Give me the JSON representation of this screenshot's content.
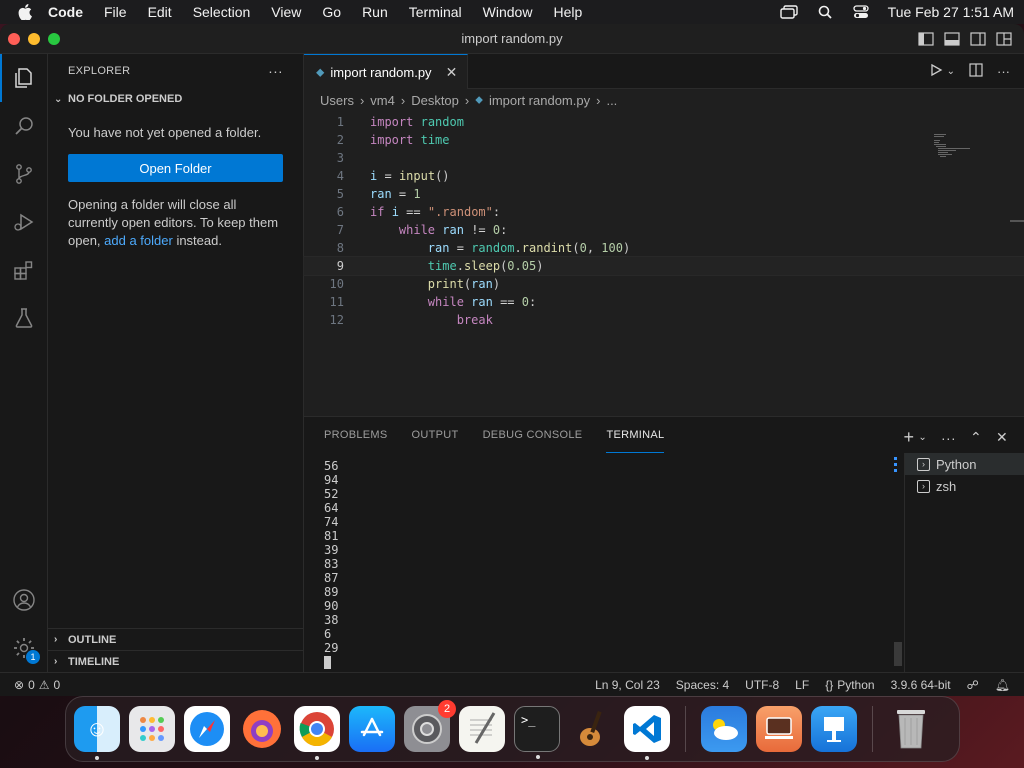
{
  "menubar": {
    "app": "Code",
    "items": [
      "File",
      "Edit",
      "Selection",
      "View",
      "Go",
      "Run",
      "Terminal",
      "Window",
      "Help"
    ],
    "clock": "Tue Feb 27  1:51 AM"
  },
  "window": {
    "title": "import random.py"
  },
  "sidebar": {
    "title": "EXPLORER",
    "section": "NO FOLDER OPENED",
    "message": "You have not yet opened a folder.",
    "open_button": "Open Folder",
    "info_1": "Opening a folder will close all currently open editors. To keep them open, ",
    "info_link": "add a folder",
    "info_2": " instead.",
    "outline": "OUTLINE",
    "timeline": "TIMELINE"
  },
  "editor": {
    "tab": "import random.py",
    "breadcrumb": [
      "Users",
      "vm4",
      "Desktop",
      "import random.py",
      "..."
    ],
    "current_line": 9
  },
  "panel": {
    "tabs": [
      "PROBLEMS",
      "OUTPUT",
      "DEBUG CONSOLE",
      "TERMINAL"
    ],
    "active_tab": "TERMINAL",
    "output": [
      "56",
      "94",
      "52",
      "64",
      "74",
      "81",
      "39",
      "83",
      "87",
      "89",
      "90",
      "38",
      "6",
      "29"
    ],
    "terminals": [
      "Python",
      "zsh"
    ]
  },
  "statusbar": {
    "errors": "0",
    "warnings": "0",
    "position": "Ln 9, Col 23",
    "spaces": "Spaces: 4",
    "encoding": "UTF-8",
    "eol": "LF",
    "language": "Python",
    "interpreter": "3.9.6 64-bit"
  },
  "dock": {
    "apps": [
      "finder-icon",
      "launchpad-icon",
      "safari-icon",
      "firefox-icon",
      "chrome-icon",
      "app-store-icon",
      "system-settings-icon",
      "textedit-icon",
      "terminal-icon",
      "garageband-icon",
      "vscode-icon",
      "weather-icon",
      "screen-sharing-icon",
      "keynote-icon",
      "trash-icon"
    ],
    "settings_badge": "2",
    "activity_badge": "1"
  },
  "colors": {
    "accent": "#0078d4",
    "editor_bg": "#1f1f1f",
    "sidebar_bg": "#181818"
  }
}
